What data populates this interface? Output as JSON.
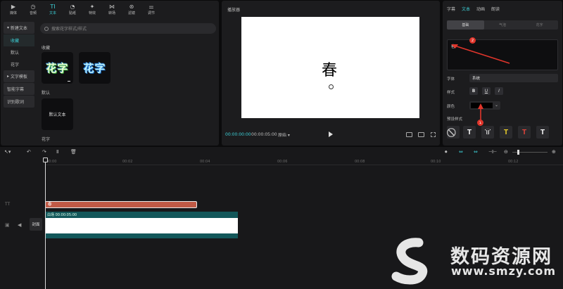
{
  "toolbar": {
    "items": [
      {
        "label": "媒体",
        "icon": "media-icon"
      },
      {
        "label": "音频",
        "icon": "audio-icon"
      },
      {
        "label": "文本",
        "icon": "text-icon",
        "active": true
      },
      {
        "label": "贴纸",
        "icon": "sticker-icon"
      },
      {
        "label": "特效",
        "icon": "effects-icon"
      },
      {
        "label": "转场",
        "icon": "transition-icon"
      },
      {
        "label": "滤镜",
        "icon": "filter-icon"
      },
      {
        "label": "调节",
        "icon": "adjust-icon"
      }
    ]
  },
  "sidebar": {
    "new_text": "新建文本",
    "favorites": "收藏",
    "default": "默认",
    "flower": "花字",
    "text_template": "文字模板",
    "smart_subtitle": "智能字幕",
    "recognize_lyrics": "识别歌词"
  },
  "search": {
    "placeholder": "搜索花字样式/样式"
  },
  "library": {
    "favorites_label": "收藏",
    "flower_text_sample": "花字",
    "default_label": "默认",
    "default_text": "默认文本",
    "flower_label": "花字"
  },
  "player": {
    "title": "播放器",
    "canvas_text": "春",
    "current_time": "00:00:00:00",
    "duration": "00:00:05:00",
    "ratio": "原始"
  },
  "inspector": {
    "tabs": [
      "字幕",
      "文本",
      "动画",
      "朗读"
    ],
    "active_tab": "文本",
    "sub_tabs": [
      "基础",
      "气泡",
      "花字"
    ],
    "active_sub_tab": "基础",
    "text_value": "春",
    "font_label": "字体",
    "font_value": "系统",
    "style_label": "样式",
    "style_buttons": [
      "B",
      "U",
      "I"
    ],
    "color_label": "颜色",
    "color_value": "#000000",
    "preset_label": "预设样式",
    "presets": [
      "T",
      "T",
      "T",
      "T",
      "T"
    ],
    "preset_colors": [
      "#ffffff",
      "#ffffff",
      "#f2d42b",
      "#e8453c",
      "#ffffff"
    ]
  },
  "annotations": {
    "badge_1": "1",
    "badge_2": "2"
  },
  "timeline": {
    "ticks": [
      "00:00",
      "00:02",
      "00:04",
      "00:06",
      "00:08",
      "00:10",
      "00:12"
    ],
    "text_clip_label": "春",
    "video_clip_label": "白场  00:00:05:00",
    "cover_label": "封面"
  },
  "watermark": {
    "name": "数码资源网",
    "url": "www.smzy.com"
  }
}
